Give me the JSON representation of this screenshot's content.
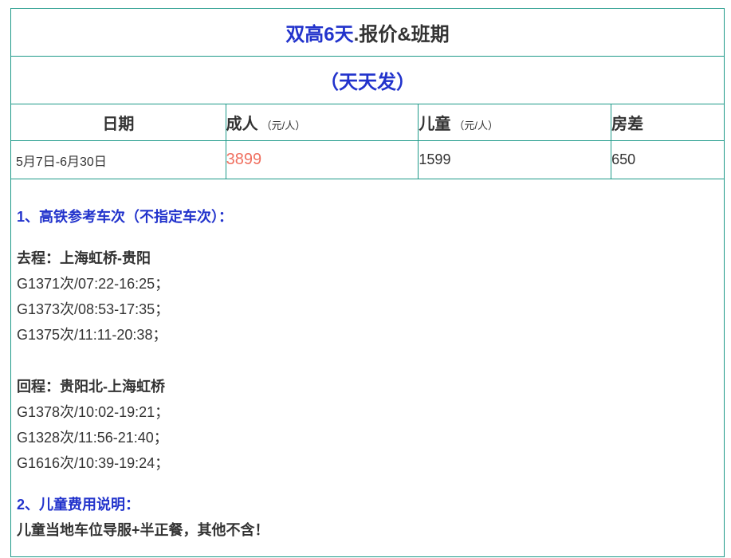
{
  "title": {
    "main": "双高6天",
    "sep": ".",
    "rest": "报价&班期"
  },
  "subtitle": "（天天发）",
  "table": {
    "headers": {
      "date": "日期",
      "adult": "成人",
      "adult_unit": "（元/人）",
      "child": "儿童",
      "child_unit": "（元/人）",
      "room": "房差"
    },
    "row": {
      "date": "5月7日-6月30日",
      "adult": "3899",
      "child": "1599",
      "room": "650"
    }
  },
  "section1": {
    "heading": "1、高铁参考车次（不指定车次）：",
    "outbound_label": "去程：上海虹桥-贵阳",
    "outbound": [
      "G1371次/07:22-16:25；",
      "G1373次/08:53-17:35；",
      "G1375次/11:11-20:38；"
    ],
    "return_label": "回程：贵阳北-上海虹桥",
    "return": [
      "G1378次/10:02-19:21；",
      "G1328次/11:56-21:40；",
      "G1616次/10:39-19:24；"
    ]
  },
  "section2": {
    "heading": "2、儿童费用说明：",
    "text": "儿童当地车位导服+半正餐，其他不含！"
  },
  "colors": {
    "border": "#1f9a8a",
    "blue": "#2233cc",
    "price": "#f07060"
  }
}
